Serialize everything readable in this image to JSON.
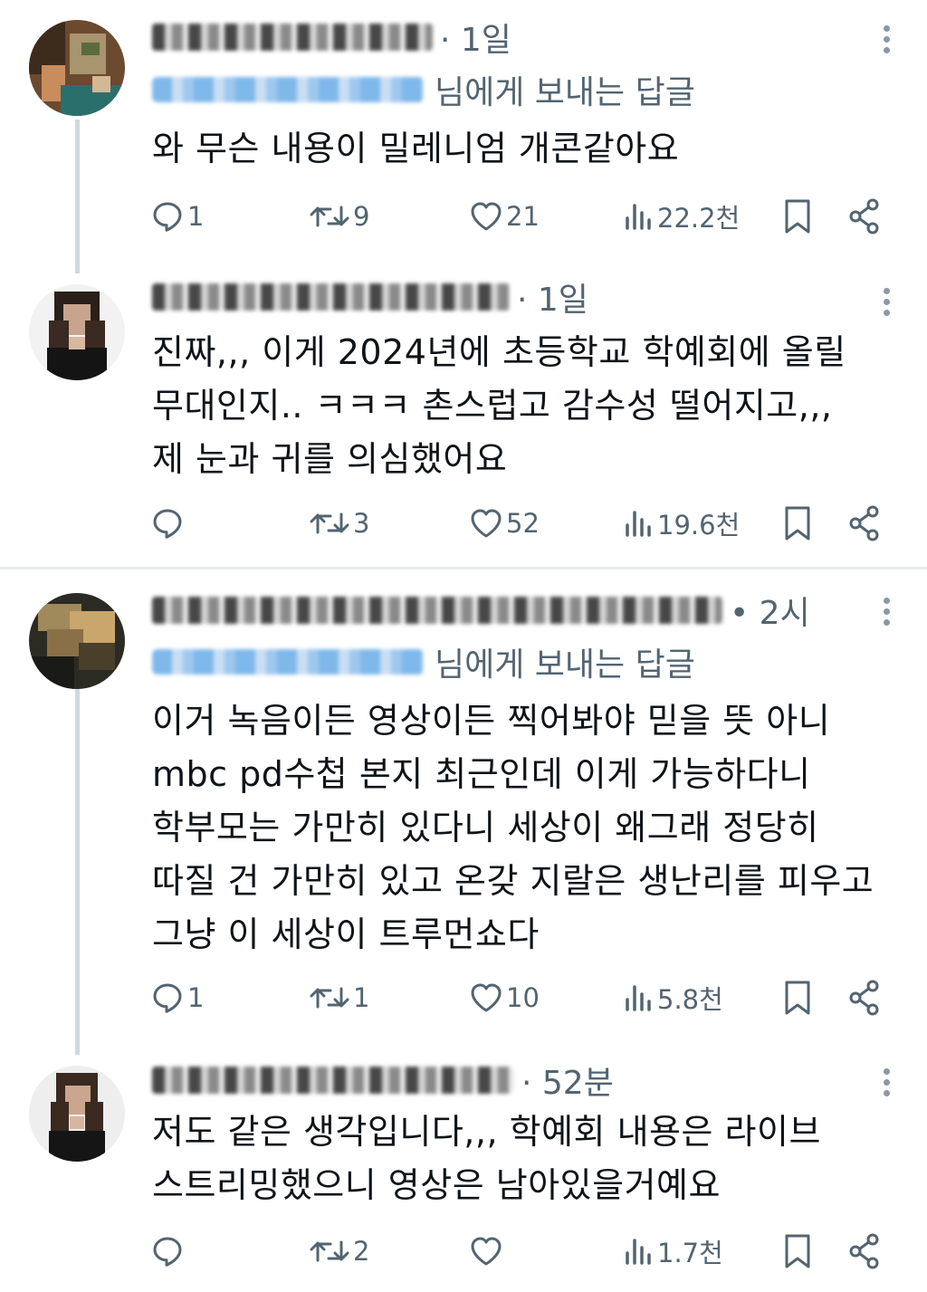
{
  "threads": [
    {
      "parent": {
        "time": "· 1일",
        "reply_to": "님에게 보내는 답글",
        "lines": [
          "와 무슨 내용이 밀레니엄 개콘같아요"
        ],
        "replies": "1",
        "retweets": "9",
        "likes": "21",
        "views": "22.2천"
      },
      "reply": {
        "time": "· 1일",
        "lines": [
          "진짜,,, 이게 2024년에 초등학교 학예회에 올릴",
          "무대인지.. ㅋㅋㅋ 촌스럽고 감수성 떨어지고,,,",
          "제 눈과 귀를 의심했어요"
        ],
        "replies": "",
        "retweets": "3",
        "likes": "52",
        "views": "19.6천"
      }
    },
    {
      "parent": {
        "time": "• 2시",
        "reply_to": "님에게 보내는 답글",
        "lines": [
          "이거 녹음이든 영상이든 찍어봐야 믿을 뜻 아니",
          "mbc pd수첩 본지 최근인데 이게 가능하다니",
          "학부모는 가만히 있다니 세상이 왜그래 정당히",
          "따질 건 가만히 있고 온갖 지랄은 생난리를 피우고",
          "그냥 이 세상이 트루먼쇼다"
        ],
        "replies": "1",
        "retweets": "1",
        "likes": "10",
        "views": "5.8천"
      },
      "reply": {
        "time": "· 52분",
        "lines": [
          "저도 같은 생각입니다,,, 학예회 내용은 라이브",
          "스트리밍했으니 영상은 남아있을거예요"
        ],
        "replies": "",
        "retweets": "2",
        "likes": "",
        "views": "1.7천"
      }
    }
  ],
  "icons": {
    "reply": "comment-bubble-icon",
    "retweet": "retweet-arrows-icon",
    "like": "heart-icon",
    "views": "bar-chart-icon",
    "bookmark": "bookmark-icon",
    "share": "share-icon",
    "more": "more-dots-icon"
  },
  "colors": {
    "text": "#0f1419",
    "meta": "#536471",
    "thread_line": "#cfd9de"
  }
}
